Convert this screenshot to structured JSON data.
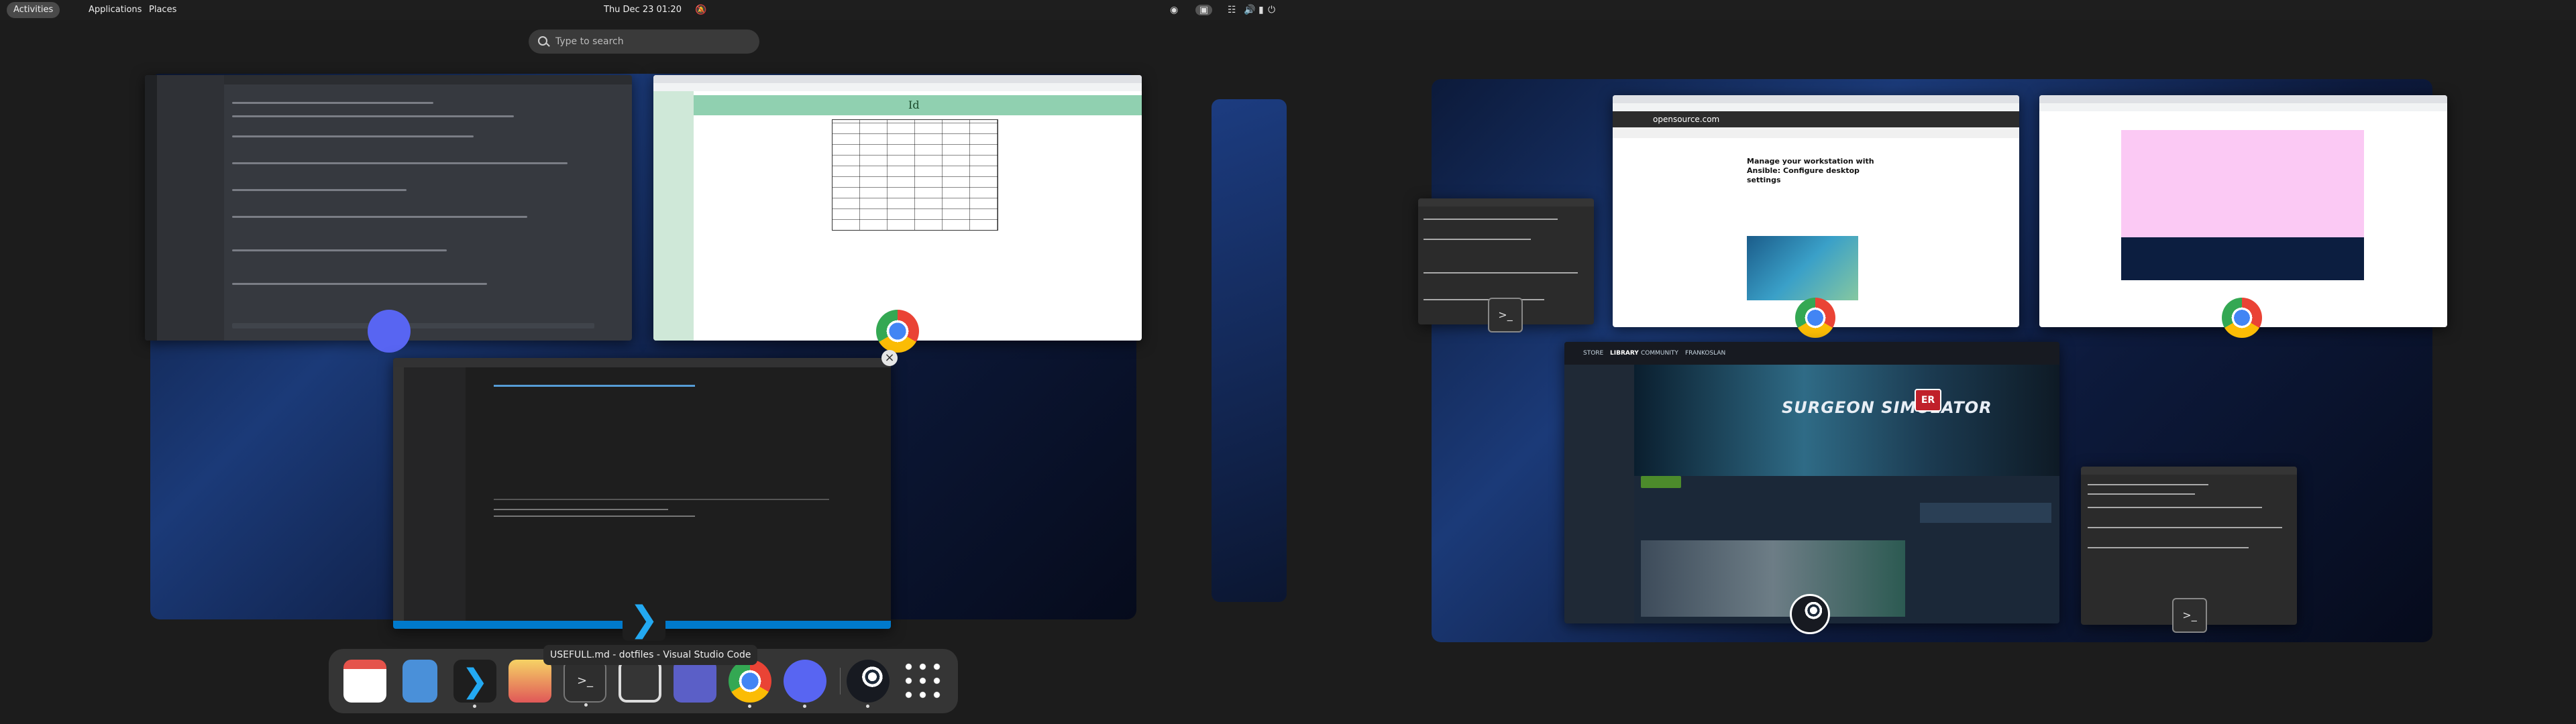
{
  "topbar": {
    "activities": "Activities",
    "applications": "Applications",
    "places": "Places",
    "clock": "Thu Dec 23  01:20"
  },
  "search": {
    "placeholder": "Type to search"
  },
  "windows": {
    "discord": {
      "app": "Discord"
    },
    "chrome_wiki": {
      "heading": "Id"
    },
    "vscode": {
      "title": "USEFULL.md - dotfiles - Visual Studio Code"
    },
    "opensource": {
      "site": "opensource.com",
      "headline": "Manage your workstation with Ansible: Configure desktop settings"
    },
    "steam": {
      "nav_items": [
        "STORE",
        "LIBRARY",
        "COMMUNITY",
        "FRANKOSLAN"
      ],
      "game_title": "SURGEON SIMULATOR",
      "badge": "ER"
    }
  },
  "dash": {
    "tooltip": "USEFULL.md - dotfiles - Visual Studio Code",
    "items": [
      "calendar",
      "text-editor",
      "vscode",
      "software",
      "terminal",
      "screenshot",
      "teams",
      "chrome",
      "discord",
      "steam",
      "app-grid"
    ]
  },
  "colors": {
    "accent": "#3584e4",
    "vscode": "#007acc",
    "discord": "#5865f2",
    "steam": "#1b2838"
  }
}
